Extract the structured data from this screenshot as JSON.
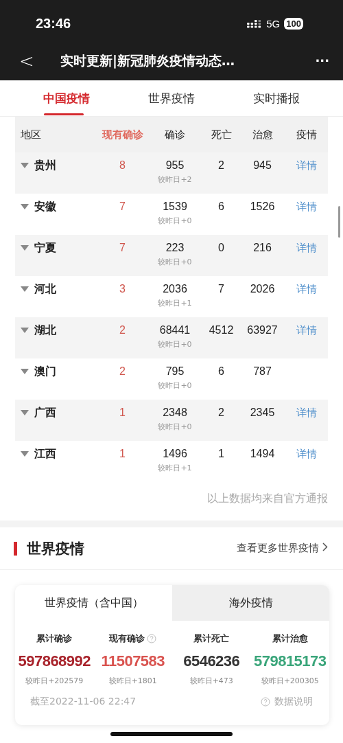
{
  "status_bar": {
    "time": "23:46",
    "network": "5G",
    "battery": "100"
  },
  "nav": {
    "back": "<",
    "title": "实时更新|新冠肺炎疫情动态…",
    "more": "···"
  },
  "tabs": [
    {
      "label": "中国疫情",
      "selected": true
    },
    {
      "label": "世界疫情",
      "selected": false
    },
    {
      "label": "实时播报",
      "selected": false
    }
  ],
  "table": {
    "columns": [
      {
        "label": "地区",
        "selected": false
      },
      {
        "label": "现有确诊",
        "selected": true
      },
      {
        "label": "确诊",
        "selected": false
      },
      {
        "label": "死亡",
        "selected": false
      },
      {
        "label": "治愈",
        "selected": false
      },
      {
        "label": "疫情",
        "selected": false
      }
    ],
    "rows": [
      {
        "region": "贵州",
        "current": "8",
        "confirmed": "955",
        "change": "较昨日+2",
        "deaths": "2",
        "cured": "945",
        "detail": "详情"
      },
      {
        "region": "安徽",
        "current": "7",
        "confirmed": "1539",
        "change": "较昨日+0",
        "deaths": "6",
        "cured": "1526",
        "detail": "详情"
      },
      {
        "region": "宁夏",
        "current": "7",
        "confirmed": "223",
        "change": "较昨日+0",
        "deaths": "0",
        "cured": "216",
        "detail": "详情"
      },
      {
        "region": "河北",
        "current": "3",
        "confirmed": "2036",
        "change": "较昨日+1",
        "deaths": "7",
        "cured": "2026",
        "detail": "详情"
      },
      {
        "region": "湖北",
        "current": "2",
        "confirmed": "68441",
        "change": "较昨日+0",
        "deaths": "4512",
        "cured": "63927",
        "detail": "详情"
      },
      {
        "region": "澳门",
        "current": "2",
        "confirmed": "795",
        "change": "较昨日+0",
        "deaths": "6",
        "cured": "787"
      },
      {
        "region": "广西",
        "current": "1",
        "confirmed": "2348",
        "change": "较昨日+0",
        "deaths": "2",
        "cured": "2345",
        "detail": "详情"
      },
      {
        "region": "江西",
        "current": "1",
        "confirmed": "1496",
        "change": "较昨日+1",
        "deaths": "1",
        "cured": "1494",
        "detail": "详情"
      }
    ],
    "note": "以上数据均来自官方通报"
  },
  "world": {
    "title": "世界疫情",
    "more_link": "查看更多世界疫情",
    "tabs": [
      {
        "label": "世界疫情（含中国）",
        "selected": true
      },
      {
        "label": "海外疫情",
        "selected": false
      }
    ],
    "stats": [
      {
        "label": "累计确诊",
        "value": "597868992",
        "change": "较昨日+202579",
        "color": "#a8232b",
        "kind": "plain"
      },
      {
        "label": "现有确诊",
        "value": "11507583",
        "change": "较昨日+1801",
        "color": "#d9534f",
        "kind": "with_help"
      },
      {
        "label": "累计死亡",
        "value": "6546236",
        "change": "较昨日+473",
        "color": "#333333",
        "kind": "plain"
      },
      {
        "label": "累计治愈",
        "value": "579815173",
        "change": "较昨日+200305",
        "color": "#3aa57a",
        "kind": "plain"
      }
    ],
    "as_of": "截至2022-11-06 22:47",
    "data_note": "数据说明"
  }
}
